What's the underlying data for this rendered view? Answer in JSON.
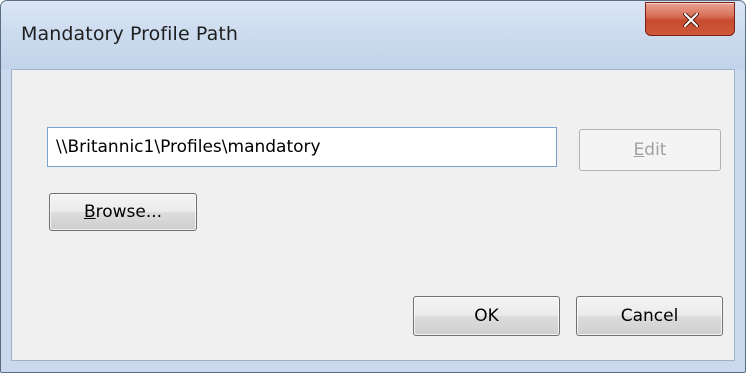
{
  "window": {
    "title": "Mandatory Profile Path",
    "close_label": "x"
  },
  "path_field": {
    "value": "\\\\Britannic1\\Profiles\\mandatory"
  },
  "edit_button": {
    "mnemonic": "E",
    "rest": "dit",
    "enabled": false
  },
  "browse_button": {
    "mnemonic": "B",
    "rest": "rowse..."
  },
  "ok_button": {
    "label": "OK"
  },
  "cancel_button": {
    "label": "Cancel"
  }
}
